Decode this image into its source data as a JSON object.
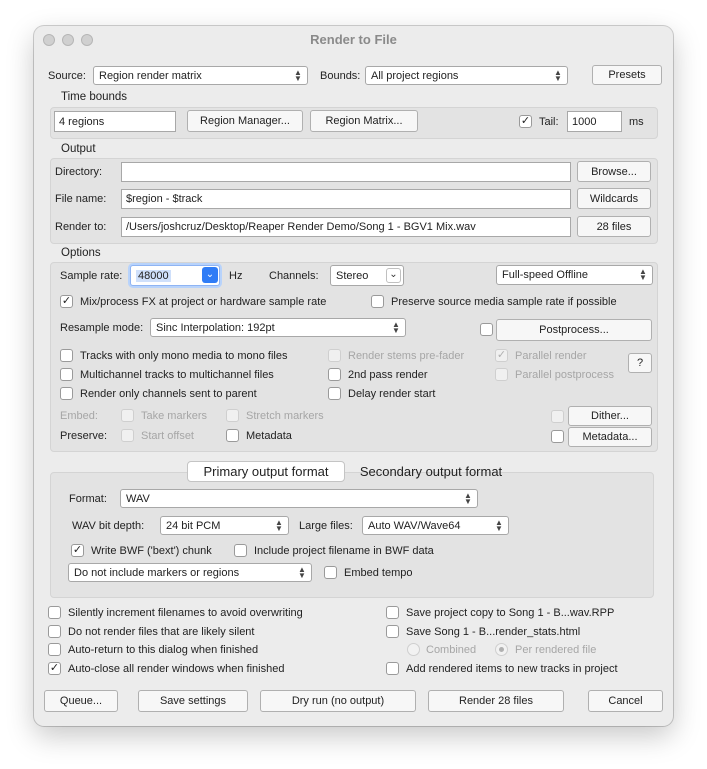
{
  "window": {
    "title": "Render to File"
  },
  "source": {
    "label": "Source:",
    "value": "Region render matrix"
  },
  "bounds": {
    "label": "Bounds:",
    "value": "All project regions"
  },
  "presets_button": "Presets",
  "time_bounds": {
    "section": "Time bounds",
    "regions_value": "4 regions",
    "region_manager_button": "Region Manager...",
    "region_matrix_button": "Region Matrix...",
    "tail_label": "Tail:",
    "tail_checked": true,
    "tail_value": "1000",
    "tail_unit": "ms"
  },
  "output": {
    "section": "Output",
    "directory_label": "Directory:",
    "directory_value": "",
    "browse_button": "Browse...",
    "filename_label": "File name:",
    "filename_value": "$region - $track",
    "wildcards_button": "Wildcards",
    "render_to_label": "Render to:",
    "render_to_value": "/Users/joshcruz/Desktop/Reaper Render Demo/Song 1 - BGV1 Mix.wav",
    "files_button": "28 files"
  },
  "options": {
    "section": "Options",
    "sample_rate_label": "Sample rate:",
    "sample_rate_value": "48000",
    "hz_label": "Hz",
    "channels_label": "Channels:",
    "channels_value": "Stereo",
    "speed_value": "Full-speed Offline",
    "mix_fx": "Mix/process FX at project or hardware sample rate",
    "preserve_sample_rate": "Preserve source media sample rate if possible",
    "resample_label": "Resample mode:",
    "resample_value": "Sinc Interpolation: 192pt",
    "postprocess_button": "Postprocess...",
    "mono_tracks": "Tracks with only mono media to mono files",
    "multichannel": "Multichannel tracks to multichannel files",
    "render_only_parent": "Render only channels sent to parent",
    "stems_prefader": "Render stems pre-fader",
    "second_pass": "2nd pass render",
    "delay_start": "Delay render start",
    "parallel_render": "Parallel render",
    "parallel_post": "Parallel postprocess",
    "help_button": "?",
    "embed_label": "Embed:",
    "take_markers": "Take markers",
    "stretch_markers": "Stretch markers",
    "preserve_label": "Preserve:",
    "start_offset": "Start offset",
    "metadata": "Metadata",
    "dither_button": "Dither...",
    "metadata_button": "Metadata..."
  },
  "format": {
    "tab_primary": "Primary output format",
    "tab_secondary": "Secondary output format",
    "format_label": "Format:",
    "format_value": "WAV",
    "bit_depth_label": "WAV bit depth:",
    "bit_depth_value": "24 bit PCM",
    "large_files_label": "Large files:",
    "large_files_value": "Auto WAV/Wave64",
    "bwf": "Write BWF ('bext') chunk",
    "include_filename": "Include project filename in BWF data",
    "markers_value": "Do not include markers or regions",
    "embed_tempo": "Embed tempo"
  },
  "bottom": {
    "silently_increment": "Silently increment filenames to avoid overwriting",
    "no_silent": "Do not render files that are likely silent",
    "auto_return": "Auto-return to this dialog when finished",
    "auto_close": "Auto-close all render windows when finished",
    "save_copy": "Save project copy to Song 1 - B...wav.RPP",
    "save_stats": "Save Song 1 - B...render_stats.html",
    "combined": "Combined",
    "per_file": "Per rendered file",
    "add_items": "Add rendered items to new tracks in project"
  },
  "buttons": {
    "queue": "Queue...",
    "save_settings": "Save settings",
    "dry_run": "Dry run (no output)",
    "render": "Render 28 files",
    "cancel": "Cancel"
  },
  "colors": {
    "accent": "#2f7cf6",
    "window_bg": "#ececec",
    "group_bg": "#e3e3e3"
  }
}
